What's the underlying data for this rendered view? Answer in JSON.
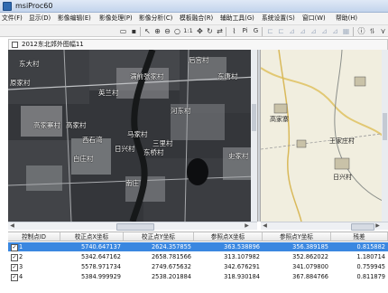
{
  "window": {
    "title": "msiProc60"
  },
  "menu": [
    "文件(F)",
    "显示(D)",
    "影像编辑(E)",
    "影像处理(P)",
    "影像分析(C)",
    "模板融合(R)",
    "辅助工具(G)",
    "系统设置(S)",
    "窗口(W)",
    "帮助(H)"
  ],
  "toolbar": {
    "zoom_label": "1:1",
    "pixel_label": "Pi",
    "g_label": "G"
  },
  "document": {
    "title": "2012东北郊外图幅11"
  },
  "image_labels": [
    "东大村",
    "后宫村",
    "原家村",
    "满前张家村",
    "东唐村",
    "英兰村",
    "高家寨村",
    "河东村",
    "西石湾",
    "马家村",
    "高家村",
    "日兴村",
    "白庄村",
    "东桥村",
    "三里村",
    "南庄",
    "史家村"
  ],
  "map_labels": [
    "高家寨",
    "王家庄村",
    "日兴村"
  ],
  "table": {
    "columns": [
      "控制点ID",
      "校正点X坐标",
      "校正点Y坐标",
      "参照点X坐标",
      "参照点Y坐标",
      "残差"
    ],
    "rows": [
      {
        "id": "1",
        "cx": "5740.647137",
        "cy": "2624.357855",
        "rx": "363.538896",
        "ry": "356.389185",
        "res": "0.815882",
        "selected": true
      },
      {
        "id": "2",
        "cx": "5342.647162",
        "cy": "2658.781566",
        "rx": "313.107982",
        "ry": "352.862022",
        "res": "1.180714",
        "selected": false
      },
      {
        "id": "3",
        "cx": "5578.971734",
        "cy": "2749.675632",
        "rx": "342.676291",
        "ry": "341.079800",
        "res": "0.759945",
        "selected": false
      },
      {
        "id": "4",
        "cx": "5384.999929",
        "cy": "2538.201884",
        "rx": "318.930184",
        "ry": "367.884766",
        "res": "0.811879",
        "selected": false
      }
    ]
  }
}
